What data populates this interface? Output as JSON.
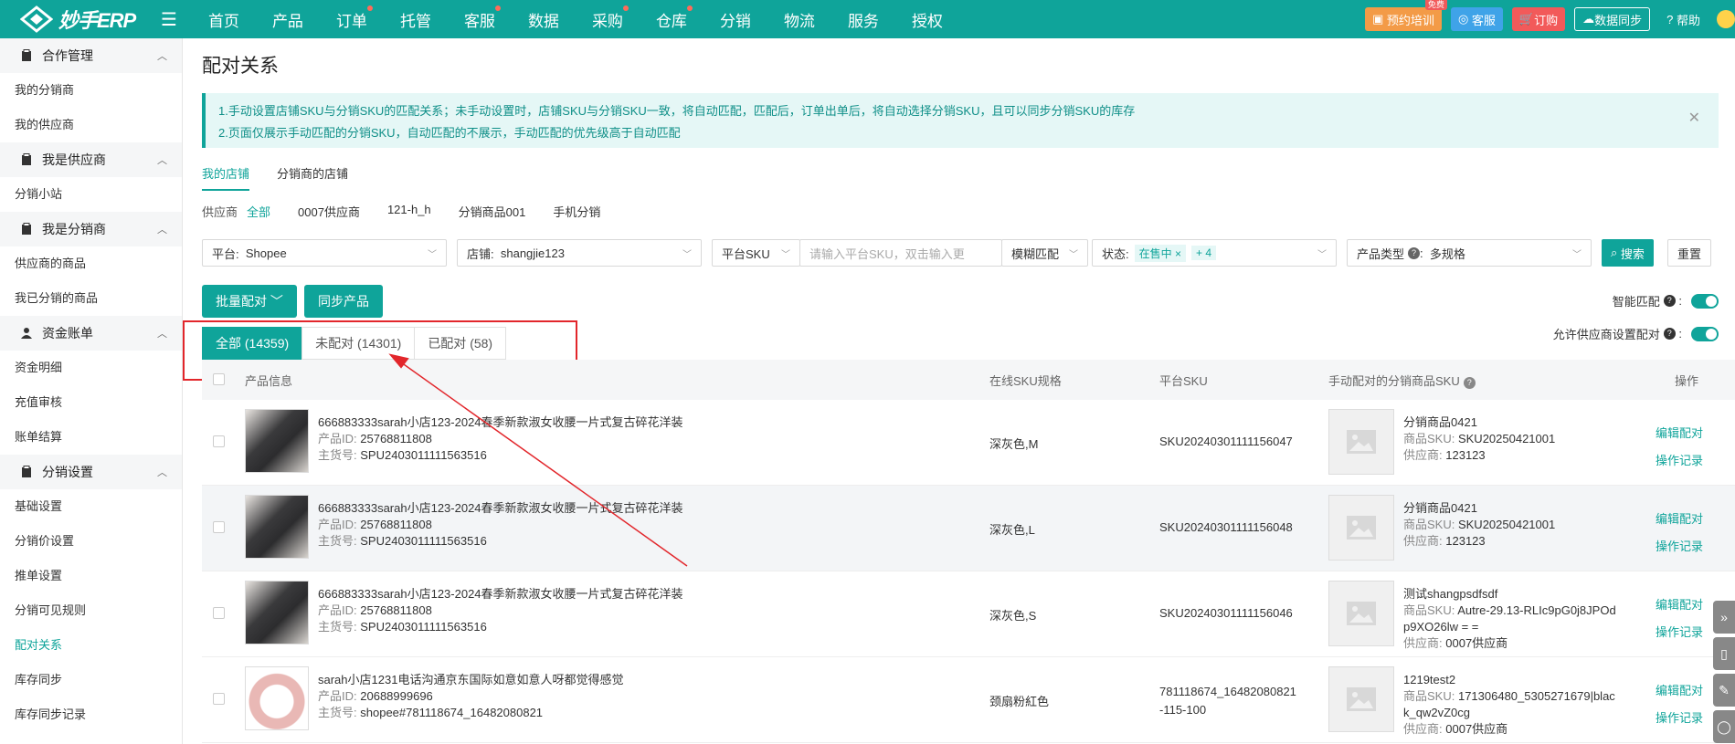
{
  "app": {
    "logo_text": "妙手ERP",
    "nav": [
      "首页",
      "产品",
      "订单",
      "托管",
      "客服",
      "数据",
      "采购",
      "仓库",
      "分销",
      "物流",
      "服务",
      "授权"
    ],
    "nav_dots": [
      "订单",
      "客服",
      "采购",
      "仓库"
    ],
    "right": {
      "train": "预约培训",
      "free_badge": "免费",
      "service": "客服",
      "order": "订购",
      "sync": "数据同步",
      "help": "帮助"
    }
  },
  "sidebar": {
    "sections": [
      {
        "title": "合作管理",
        "items": [
          "我的分销商",
          "我的供应商"
        ]
      },
      {
        "title": "我是供应商",
        "items": [
          "分销小站"
        ]
      },
      {
        "title": "我是分销商",
        "items": [
          "供应商的商品",
          "我已分销的商品"
        ]
      },
      {
        "title": "资金账单",
        "items": [
          "资金明细",
          "充值审核",
          "账单结算"
        ]
      },
      {
        "title": "分销设置",
        "items": [
          "基础设置",
          "分销价设置",
          "推单设置",
          "分销可见规则",
          "配对关系",
          "库存同步",
          "库存同步记录"
        ]
      }
    ],
    "active_item": "配对关系"
  },
  "page": {
    "title": "配对关系",
    "notice_lines": [
      "1.手动设置店铺SKU与分销SKU的匹配关系；未手动设置时，店铺SKU与分销SKU一致，将自动匹配，匹配后，订单出单后，将自动选择分销SKU，且可以同步分销SKU的库存",
      "2.页面仅展示手动匹配的分销SKU，自动匹配的不展示，手动匹配的优先级高于自动匹配"
    ],
    "store_tabs": [
      "我的店铺",
      "分销商的店铺"
    ],
    "supplier_label": "供应商",
    "suppliers": [
      "全部",
      "0007供应商",
      "121-h_h",
      "分销商品001",
      "手机分销"
    ],
    "filters": {
      "platform_label": "平台:",
      "platform_value": "Shopee",
      "store_label": "店铺:",
      "store_value": "shangjie123",
      "sku_type": "平台SKU",
      "sku_placeholder": "请输入平台SKU，双击输入更",
      "match_mode": "模糊匹配",
      "status_label": "状态:",
      "status_tag": "在售中",
      "status_more": "+ 4",
      "product_type_label": "产品类型",
      "product_type_value": "多规格",
      "search": "搜索",
      "reset": "重置"
    },
    "actions": {
      "batch": "批量配对",
      "sync": "同步产品",
      "smart_match": "智能匹配",
      "allow_supplier": "允许供应商设置配对"
    },
    "tabs": [
      {
        "label": "全部 (14359)",
        "active": true
      },
      {
        "label": "未配对 (14301)",
        "active": false
      },
      {
        "label": "已配对 (58)",
        "active": false
      }
    ],
    "table": {
      "headers": [
        "产品信息",
        "在线SKU规格",
        "平台SKU",
        "手动配对的分销商品SKU",
        "操作"
      ],
      "rows": [
        {
          "name": "666883333sarah小店123-2024春季新款淑女收腰一片式复古碎花洋装",
          "product_id_label": "产品ID:",
          "product_id": "25768811808",
          "sku_main_label": "主货号:",
          "sku_main": "SPU2403011111563516",
          "spec": "深灰色,M",
          "platform_sku": "SKU20240301111156047",
          "dist_name": "分销商品0421",
          "dist_sku_label": "商品SKU:",
          "dist_sku": "SKU20250421001",
          "supplier_label": "供应商:",
          "supplier": "123123",
          "op1": "编辑配对",
          "op2": "操作记录"
        },
        {
          "name": "666883333sarah小店123-2024春季新款淑女收腰一片式复古碎花洋装",
          "product_id_label": "产品ID:",
          "product_id": "25768811808",
          "sku_main_label": "主货号:",
          "sku_main": "SPU2403011111563516",
          "spec": "深灰色,L",
          "platform_sku": "SKU20240301111156048",
          "dist_name": "分销商品0421",
          "dist_sku_label": "商品SKU:",
          "dist_sku": "SKU20250421001",
          "supplier_label": "供应商:",
          "supplier": "123123",
          "op1": "编辑配对",
          "op2": "操作记录"
        },
        {
          "name": "666883333sarah小店123-2024春季新款淑女收腰一片式复古碎花洋装",
          "product_id_label": "产品ID:",
          "product_id": "25768811808",
          "sku_main_label": "主货号:",
          "sku_main": "SPU2403011111563516",
          "spec": "深灰色,S",
          "platform_sku": "SKU20240301111156046",
          "dist_name": "测试shangpsdfsdf",
          "dist_sku_label": "商品SKU:",
          "dist_sku": "Autre-29.13-RLIc9pG0j8JPOd p9XO26lw = =",
          "supplier_label": "供应商:",
          "supplier": "0007供应商",
          "op1": "编辑配对",
          "op2": "操作记录"
        },
        {
          "name": "sarah小店1231电话沟通京东国际如意如意人呀都觉得感觉",
          "product_id_label": "产品ID:",
          "product_id": "20688999696",
          "sku_main_label": "主货号:",
          "sku_main": "shopee#781118674_16482080821",
          "spec": "颈扇粉紅色",
          "platform_sku": "781118674_16482080821 -115-100",
          "dist_name": "1219test2",
          "dist_sku_label": "商品SKU:",
          "dist_sku": "171306480_5305271679|blac k_qw2vZ0cg",
          "supplier_label": "供应商:",
          "supplier": "0007供应商",
          "op1": "编辑配对",
          "op2": "操作记录"
        }
      ]
    }
  },
  "colors": {
    "brand": "#0fa49a",
    "highlight": "#e2262b"
  }
}
